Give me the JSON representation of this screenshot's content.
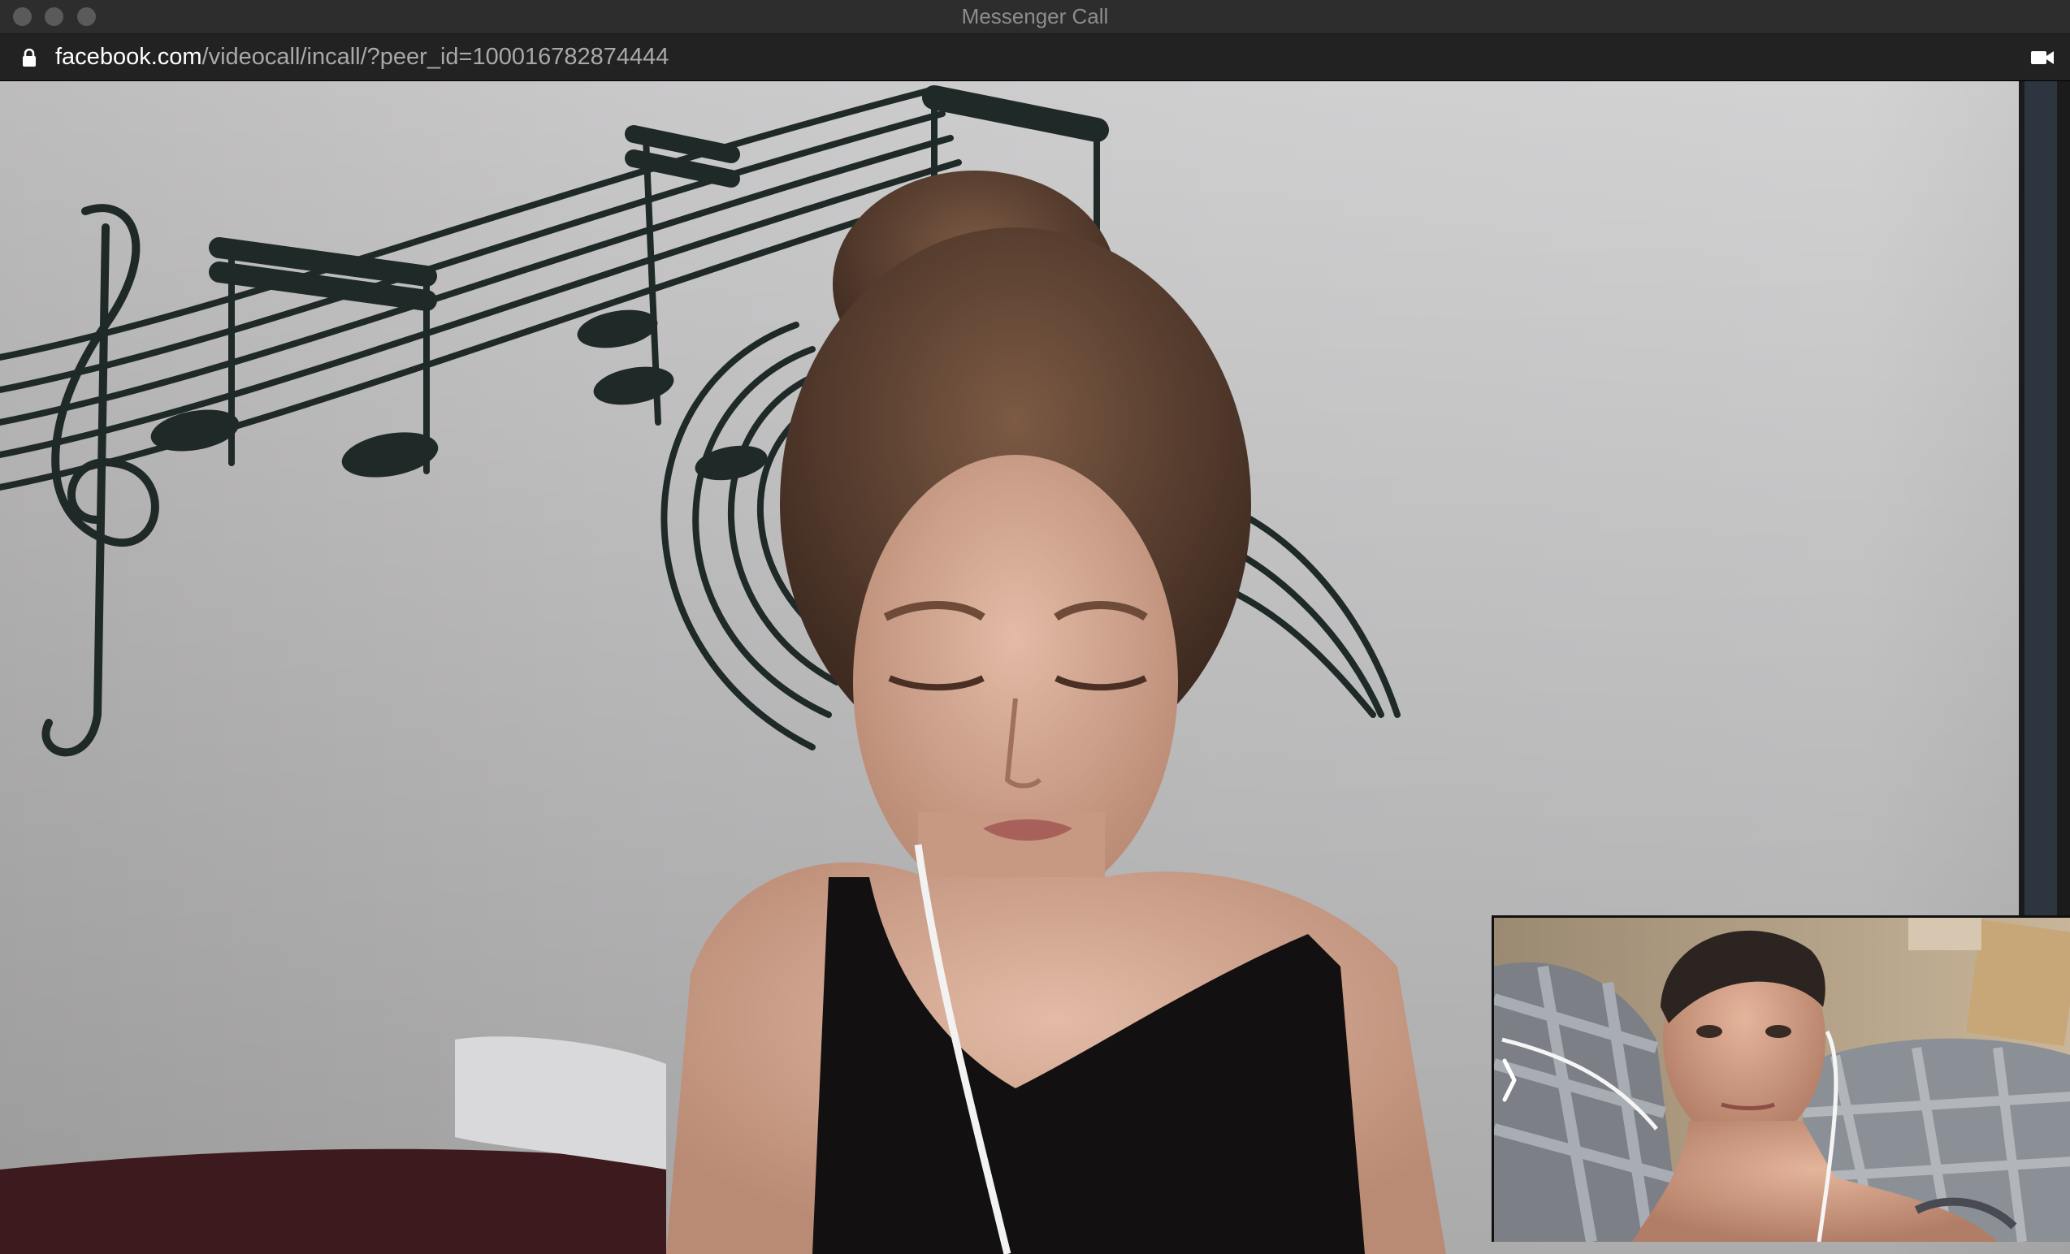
{
  "window": {
    "title": "Messenger Call"
  },
  "urlbar": {
    "domain": "facebook.com",
    "path": "/videocall/incall/?peer_id=100016782874444"
  },
  "icons": {
    "lock": "lock-icon",
    "camera": "video-camera-icon",
    "chevron": "chevron-right-icon"
  },
  "colors": {
    "titlebar": "#2d2d2d",
    "urlbar": "#222222",
    "domain_text": "#ffffff",
    "path_text": "#a9a9a9"
  }
}
